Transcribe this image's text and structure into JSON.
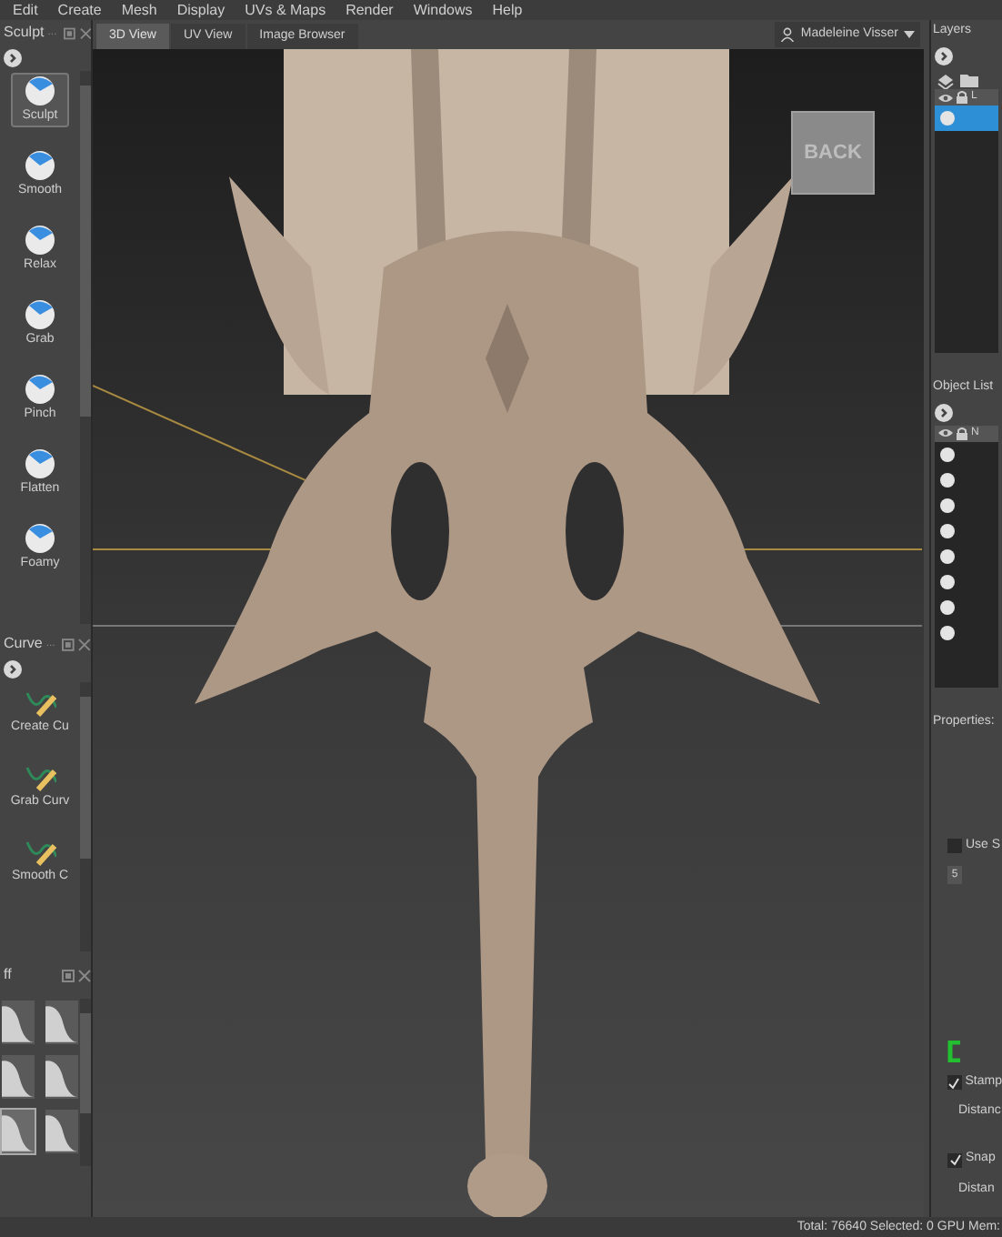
{
  "menu": [
    "Edit",
    "Create",
    "Mesh",
    "Display",
    "UVs & Maps",
    "Render",
    "Windows",
    "Help"
  ],
  "sculpt_tray": {
    "title": "Sculpt",
    "more": "...",
    "tools": [
      {
        "label": "Sculpt",
        "selected": true
      },
      {
        "label": "Smooth",
        "selected": false
      },
      {
        "label": "Relax",
        "selected": false
      },
      {
        "label": "Grab",
        "selected": false
      },
      {
        "label": "Pinch",
        "selected": false
      },
      {
        "label": "Flatten",
        "selected": false
      },
      {
        "label": "Foamy",
        "selected": false
      }
    ]
  },
  "curve_tray": {
    "title": "Curve",
    "more": "...",
    "tools": [
      {
        "label": "Create Cu",
        "selected": false
      },
      {
        "label": "Grab Curv",
        "selected": false
      },
      {
        "label": "Smooth C",
        "selected": false
      }
    ]
  },
  "falloff_tray": {
    "title": "ff",
    "falloffs": [
      {
        "selected": false
      },
      {
        "selected": false
      },
      {
        "selected": false
      },
      {
        "selected": false
      },
      {
        "selected": true
      },
      {
        "selected": false
      }
    ]
  },
  "tabs": [
    {
      "label": "3D View",
      "selected": true
    },
    {
      "label": "UV View",
      "selected": false
    },
    {
      "label": "Image Browser",
      "selected": false
    }
  ],
  "user": "Madeleine Visser",
  "viewport": {
    "view_cube": "BACK"
  },
  "layers": {
    "title": "Layers",
    "column": "L",
    "rows": [
      {
        "selected": true
      }
    ]
  },
  "object_list": {
    "title": "Object List",
    "column": "N",
    "rows": [
      {
        "selected": false
      },
      {
        "selected": false
      },
      {
        "selected": false
      },
      {
        "selected": false
      },
      {
        "selected": false
      },
      {
        "selected": false
      },
      {
        "selected": false
      },
      {
        "selected": false
      }
    ]
  },
  "properties": {
    "title": "Properties:",
    "items": [
      {
        "kind": "checkbox",
        "label": "Use S",
        "checked": false
      },
      {
        "kind": "field",
        "value": "5"
      },
      {
        "kind": "marker"
      },
      {
        "kind": "checkbox",
        "label": "Stamp",
        "checked": true
      },
      {
        "kind": "label",
        "label": "Distanc"
      },
      {
        "kind": "checkbox",
        "label": "Snap",
        "checked": true
      },
      {
        "kind": "label",
        "label": "Distan"
      }
    ]
  },
  "status_bar": "Total: 76640  Selected: 0 GPU Mem:"
}
